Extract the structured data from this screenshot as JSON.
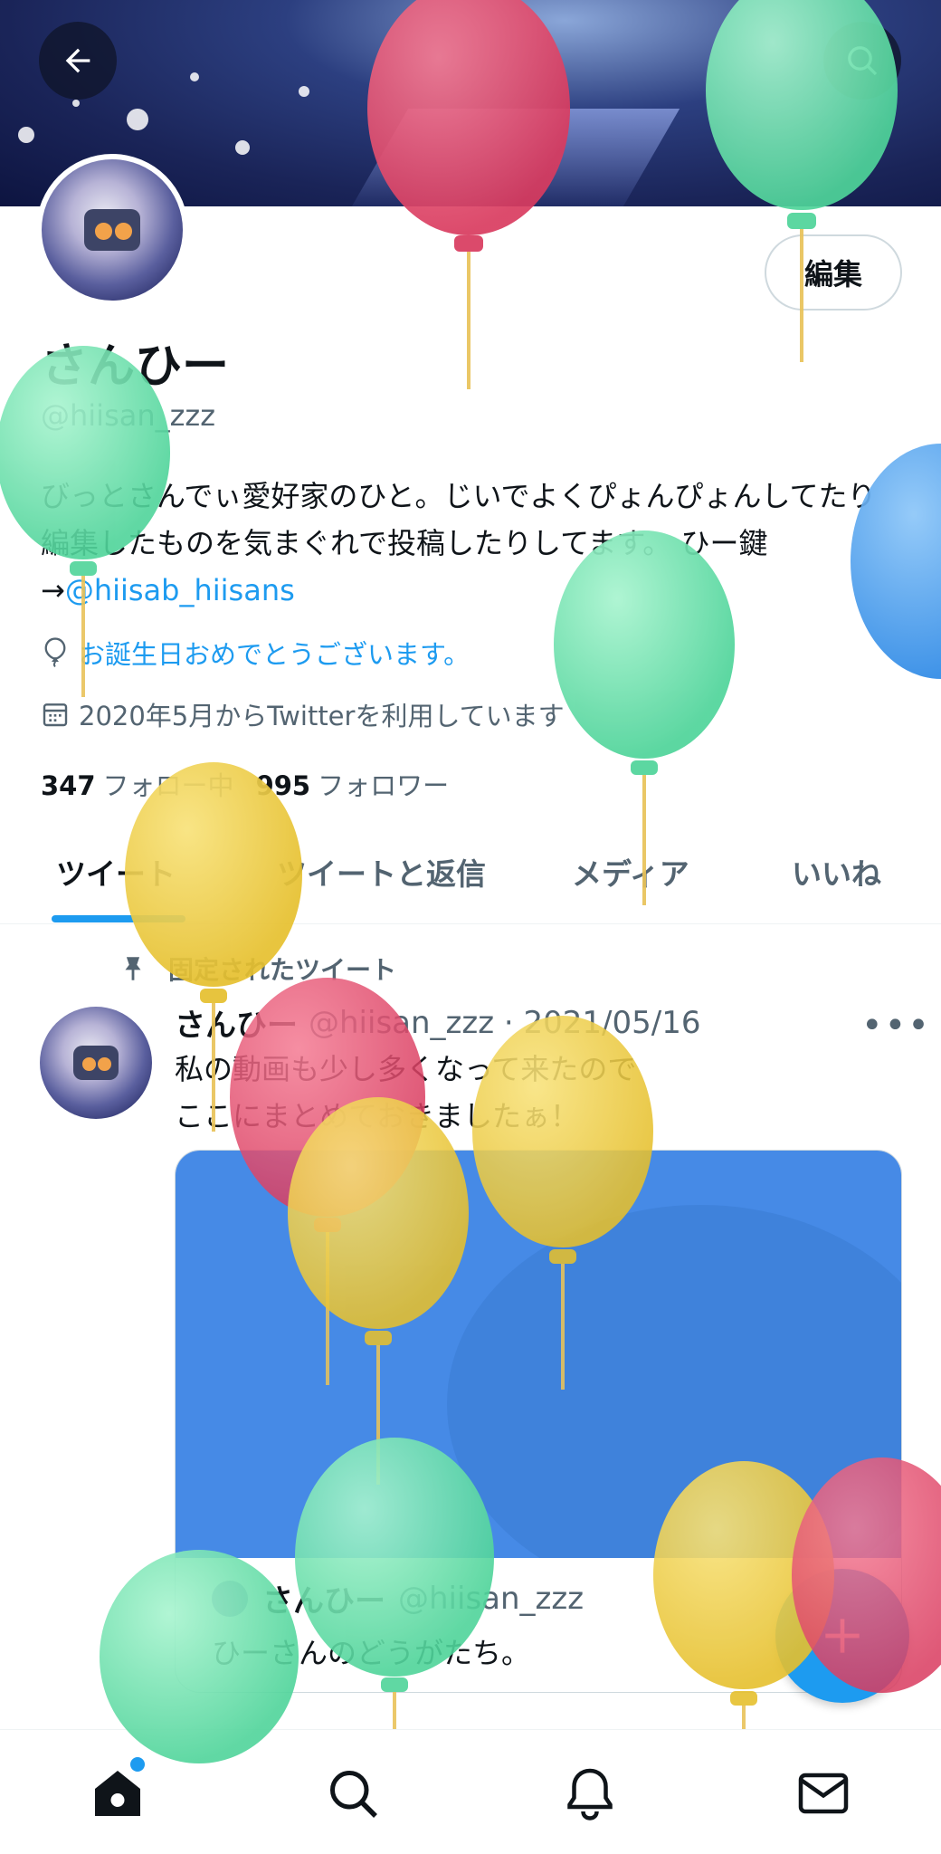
{
  "header": {
    "back_icon": "arrow-left-icon",
    "search_icon": "search-icon"
  },
  "profile": {
    "edit_label": "編集",
    "name": "さんひー",
    "handle": "@hiisan_zzz",
    "bio_text": "びっとさんでぃ愛好家のひと。じいでよくぴょんぴょんしてたり編集したものを気まぐれで投稿したりしてます。 ひー鍵→",
    "bio_mention": "@hiisab_hiisans",
    "birthday_text": "お誕生日おめでとうございます。",
    "joined_text": "2020年5月からTwitterを利用しています",
    "following_count": "347",
    "following_label": "フォロー中",
    "followers_count": "995",
    "followers_label": "フォロワー"
  },
  "tabs": [
    {
      "label": "ツイート"
    },
    {
      "label": "ツイートと返信"
    },
    {
      "label": "メディア"
    },
    {
      "label": "いいね"
    }
  ],
  "tweet": {
    "pinned_label": "固定されたツイート",
    "name": "さんひー",
    "handle_date": "@hiisan_zzz · 2021/05/16",
    "text_line1": "私の動画も少し多くなって来たので",
    "text_line2": "ここにまとめておきましたぁ！",
    "card_name": "さんひー",
    "card_handle": "@hiisan_zzz",
    "card_desc": "ひーさんのどうがたち。",
    "more_label": "•••"
  },
  "fab": {
    "icon": "plus-icon"
  },
  "bottom_nav": [
    {
      "icon": "home-icon"
    },
    {
      "icon": "search-icon"
    },
    {
      "icon": "bell-icon"
    },
    {
      "icon": "mail-icon"
    }
  ],
  "colors": {
    "accent": "#1d9bf0",
    "balloon_red": "#e8506e",
    "balloon_green": "#6fe3b0",
    "balloon_yellow": "#f2d24f",
    "balloon_blue": "#4aa3f0"
  }
}
